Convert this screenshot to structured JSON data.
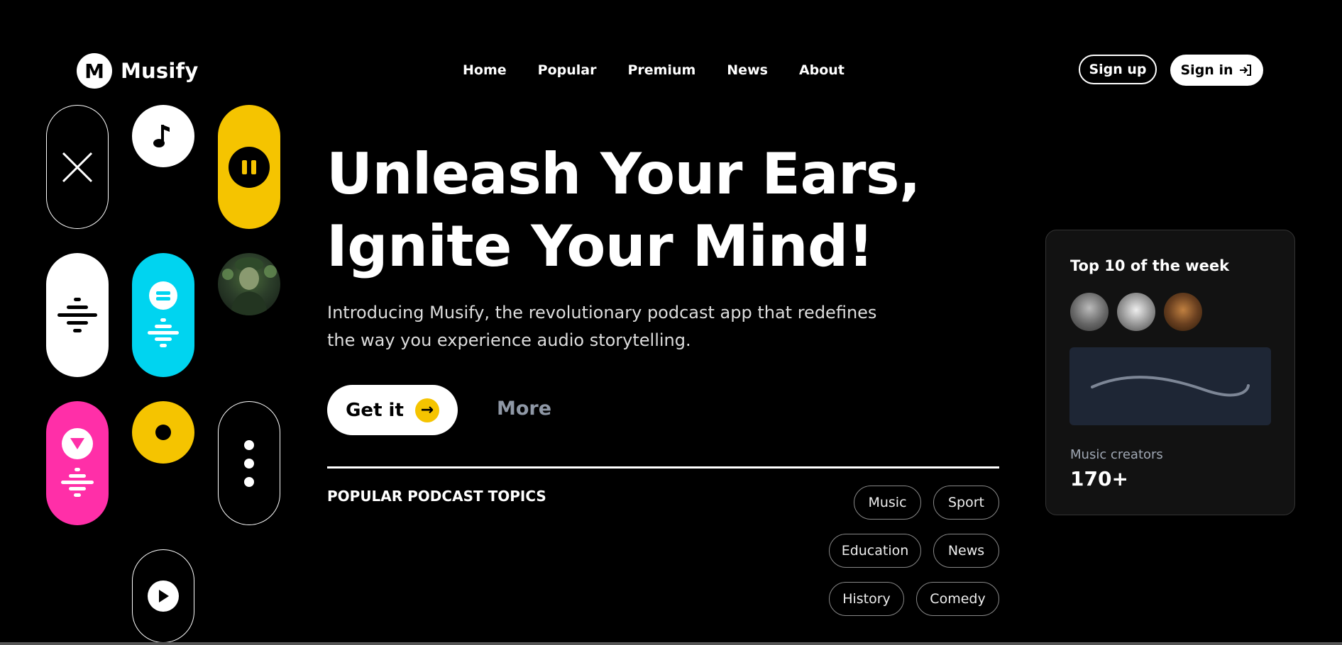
{
  "brand": {
    "logo_letter": "M",
    "name": "Musify"
  },
  "nav": {
    "items": [
      "Home",
      "Popular",
      "Premium",
      "News",
      "About"
    ]
  },
  "auth": {
    "signup": "Sign up",
    "signin": "Sign in"
  },
  "hero": {
    "title_line1": "Unleash Your Ears,",
    "title_line2": "Ignite Your Mind!",
    "subtitle": "Introducing Musify, the revolutionary podcast app that redefines the way you experience audio storytelling.",
    "cta_primary": "Get it",
    "cta_arrow": "→",
    "cta_secondary": "More"
  },
  "topics": {
    "title": "POPULAR PODCAST TOPICS",
    "tags": [
      "Music",
      "Sport",
      "Education",
      "News",
      "History",
      "Comedy"
    ]
  },
  "card": {
    "title": "Top 10 of the week",
    "stat_label": "Music creators",
    "stat_value": "170+"
  },
  "colors": {
    "yellow": "#f5c400",
    "cyan": "#00d4f0",
    "pink": "#ff2fa8",
    "background": "#000000"
  },
  "icons": [
    "close-icon",
    "music-note-icon",
    "pause-icon",
    "wave-icon",
    "menu-icon",
    "heart-icon",
    "record-icon",
    "more-vertical-icon",
    "play-icon",
    "sign-in-icon",
    "arrow-right-icon"
  ]
}
